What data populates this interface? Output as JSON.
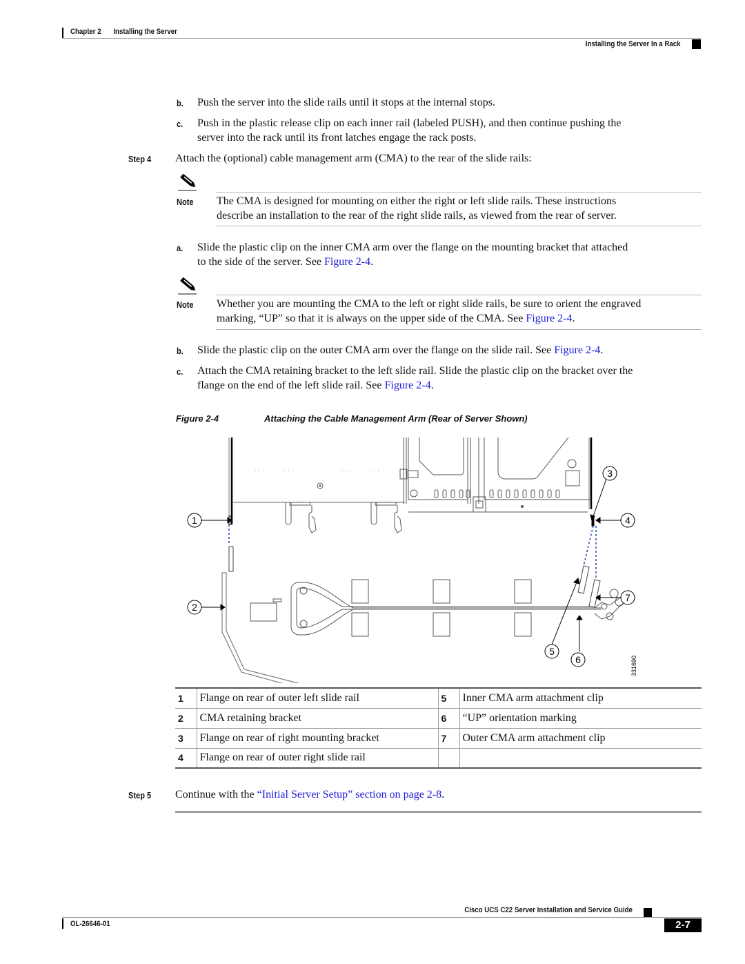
{
  "header": {
    "chapter": "Chapter 2",
    "chapter_title": "Installing the Server",
    "section": "Installing the Server In a Rack"
  },
  "steps": {
    "b_label": "b.",
    "b_text": "Push the server into the slide rails until it stops at the internal stops.",
    "c_label": "c.",
    "c_text_1": "Push in the plastic release clip on each inner rail (labeled PUSH), and then continue pushing the",
    "c_text_2": "server into the rack until its front latches engage the rack posts.",
    "step4_label": "Step 4",
    "step4_text": "Attach the (optional) cable management arm (CMA) to the rear of the slide rails:",
    "note1_label": "Note",
    "note1_text_1": "The CMA is designed for mounting on either the right or left slide rails. These instructions",
    "note1_text_2": "describe an installation to the rear of the right slide rails, as viewed from the rear of server.",
    "a_label": "a.",
    "a_text_1": "Slide the plastic clip on the inner CMA arm over the flange on the mounting bracket that attached",
    "a_text_2_pre": "to the side of the server. See ",
    "a_link": "Figure 2-4",
    "a_text_2_post": ".",
    "note2_label": "Note",
    "note2_text_1": "Whether you are mounting the CMA to the left or right slide rails, be sure to orient the engraved",
    "note2_text_2_pre": "marking, “UP” so that it is always on the upper side of the CMA. See ",
    "note2_link": "Figure 2-4",
    "note2_text_2_post": ".",
    "b2_label": "b.",
    "b2_text_pre": "Slide the plastic clip on the outer CMA arm over the flange on the slide rail. See ",
    "b2_link": "Figure 2-4",
    "b2_text_post": ".",
    "c2_label": "c.",
    "c2_text_1": "Attach the CMA retaining bracket to the left slide rail. Slide the plastic clip on the bracket over the",
    "c2_text_2_pre": "flange on the end of the left slide rail. See ",
    "c2_link": "Figure 2-4",
    "c2_text_2_post": ".",
    "step5_label": "Step 5",
    "step5_pre": "Continue with the ",
    "step5_link": "“Initial Server Setup” section on page 2-8",
    "step5_post": "."
  },
  "figure": {
    "number": "Figure 2-4",
    "caption": "Attaching the Cable Management Arm (Rear of Server Shown)",
    "callouts": [
      "1",
      "2",
      "3",
      "4",
      "5",
      "6",
      "7"
    ],
    "art_id": "331690"
  },
  "legend": [
    {
      "num": "1",
      "text": "Flange on rear of outer left slide rail",
      "num2": "5",
      "text2": "Inner CMA arm attachment clip"
    },
    {
      "num": "2",
      "text": "CMA retaining bracket",
      "num2": "6",
      "text2": "“UP” orientation marking"
    },
    {
      "num": "3",
      "text": "Flange on rear of right mounting bracket",
      "num2": "7",
      "text2": "Outer CMA arm attachment clip"
    },
    {
      "num": "4",
      "text": "Flange on rear of outer right slide rail",
      "num2": "",
      "text2": ""
    }
  ],
  "footer": {
    "guide_title": "Cisco UCS C22 Server Installation and Service Guide",
    "doc_id": "OL-26646-01",
    "page": "2-7"
  },
  "colors": {
    "link": "#1a1ad8",
    "dashed_guide": "#2b4fb3"
  }
}
